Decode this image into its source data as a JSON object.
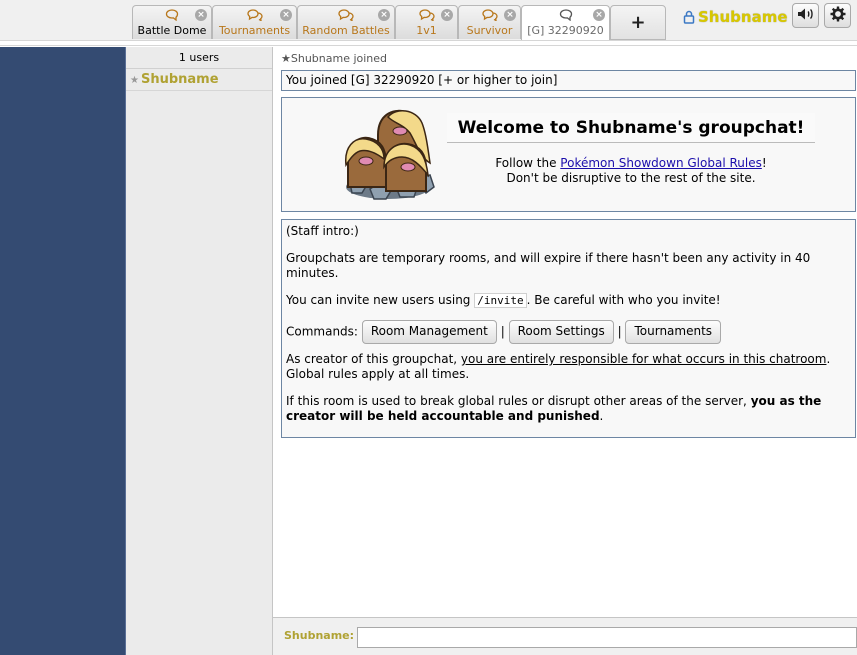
{
  "tabs": [
    {
      "label": "Battle Dome",
      "type": "room",
      "closable": true
    },
    {
      "label": "Tournaments",
      "type": "room",
      "closable": true
    },
    {
      "label": "Random Battles",
      "type": "room",
      "closable": true
    },
    {
      "label": "1v1",
      "type": "room",
      "closable": true
    },
    {
      "label": "Survivor",
      "type": "room",
      "closable": true
    },
    {
      "label": "[G] 32290920",
      "type": "groupchat",
      "closable": true,
      "active": true
    }
  ],
  "new_tab_label": "+",
  "user": {
    "name": "Shubname"
  },
  "header_buttons": {
    "sound": "volume-icon",
    "options": "gear-icon"
  },
  "userlist": {
    "count_label": "1 users",
    "users": [
      {
        "name": "Shubname",
        "rank": "★"
      }
    ]
  },
  "chat": {
    "join_note": "★Shubname joined",
    "joined_message": "You joined [G] 32290920 [+ or higher to join]",
    "welcome": {
      "title": "Welcome to Shubname's groupchat!",
      "follow_prefix": "Follow the ",
      "rules_link": "Pokémon Showdown Global Rules",
      "follow_suffix": "!",
      "line2": "Don't be disruptive to the rest of the site."
    },
    "intro": {
      "staff_intro": "(Staff intro:)",
      "expire": "Groupchats are temporary rooms, and will expire if there hasn't been any activity in 40 minutes.",
      "invite_prefix": "You can invite new users using ",
      "invite_code": "/invite",
      "invite_suffix": ". Be careful with who you invite!",
      "commands_label": "Commands:",
      "commands": [
        "Room Management",
        "Room Settings",
        "Tournaments"
      ],
      "separator": "|",
      "creator_prefix": "As creator of this groupchat, ",
      "creator_underlined": "you are entirely responsible for what occurs in this chatroom",
      "creator_suffix": ". Global rules apply at all times.",
      "break_prefix": "If this room is used to break global rules or disrupt other areas of the server, ",
      "break_bold": "you as the creator will be held accountable and punished",
      "break_suffix": "."
    }
  },
  "chatbar": {
    "name_label": "Shubname:",
    "input_value": ""
  }
}
